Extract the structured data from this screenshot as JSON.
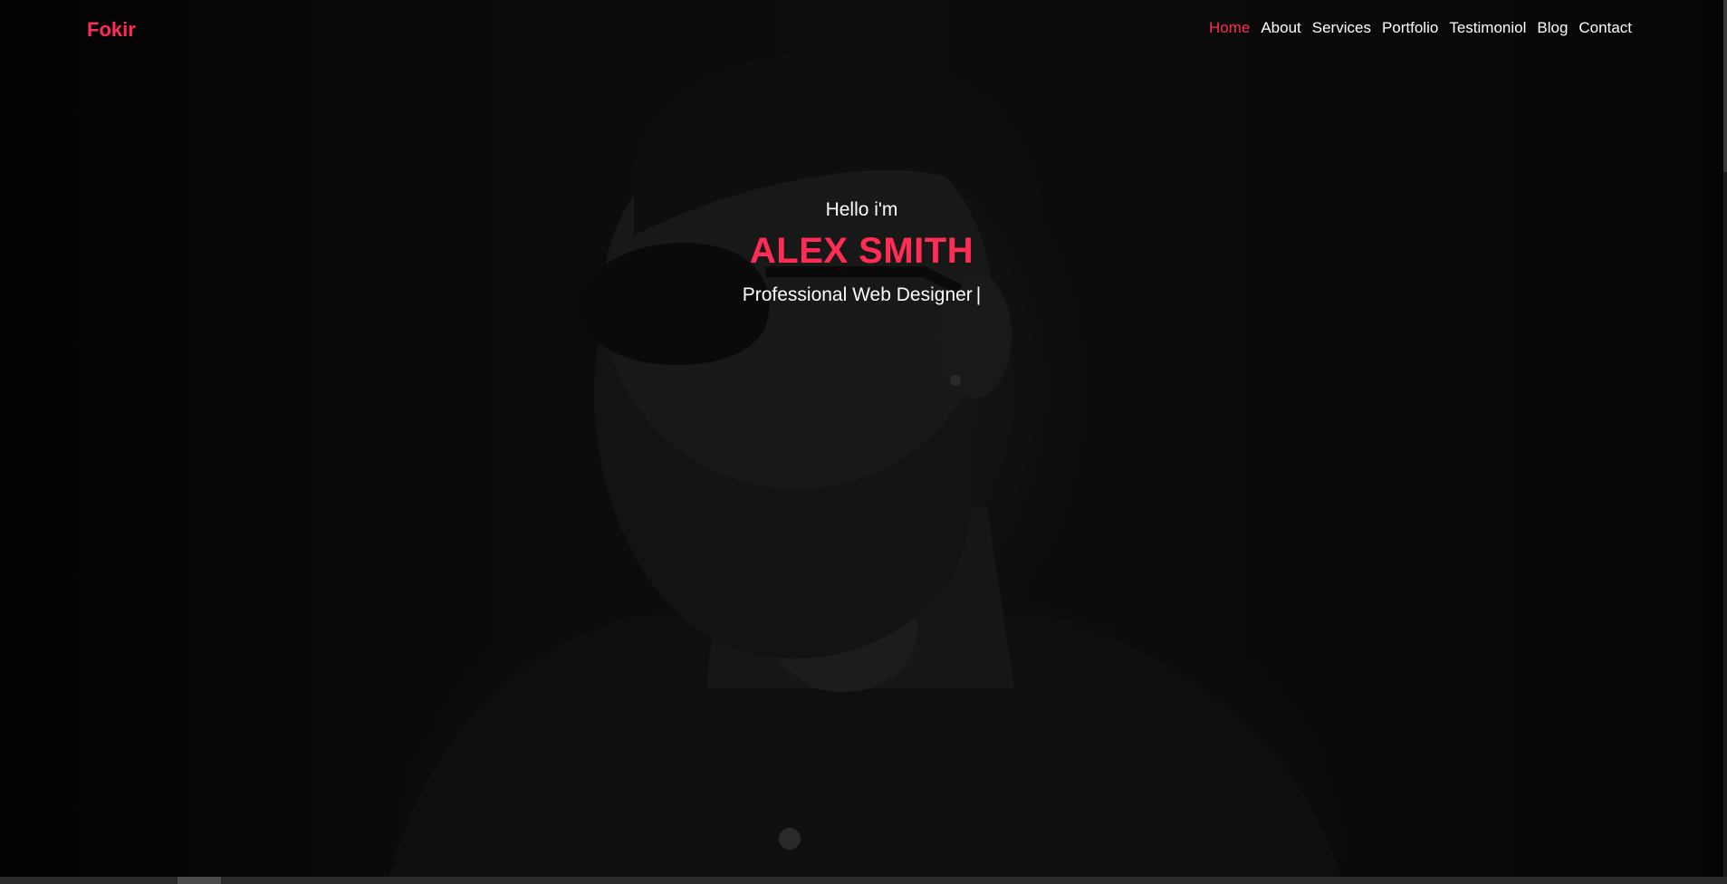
{
  "brand": {
    "name": "Fokir"
  },
  "nav": {
    "items": [
      {
        "label": "Home",
        "active": true
      },
      {
        "label": "About",
        "active": false
      },
      {
        "label": "Services",
        "active": false
      },
      {
        "label": "Portfolio",
        "active": false
      },
      {
        "label": "Testimoniol",
        "active": false
      },
      {
        "label": "Blog",
        "active": false
      },
      {
        "label": "Contact",
        "active": false
      }
    ]
  },
  "hero": {
    "greeting": "Hello i'm",
    "name": "ALEX SMITH",
    "role": "Professional Web Designer",
    "cursor": "|"
  },
  "colors": {
    "accent": "#ff2d55",
    "text": "#ffffff",
    "background": "#0b0b0b"
  }
}
